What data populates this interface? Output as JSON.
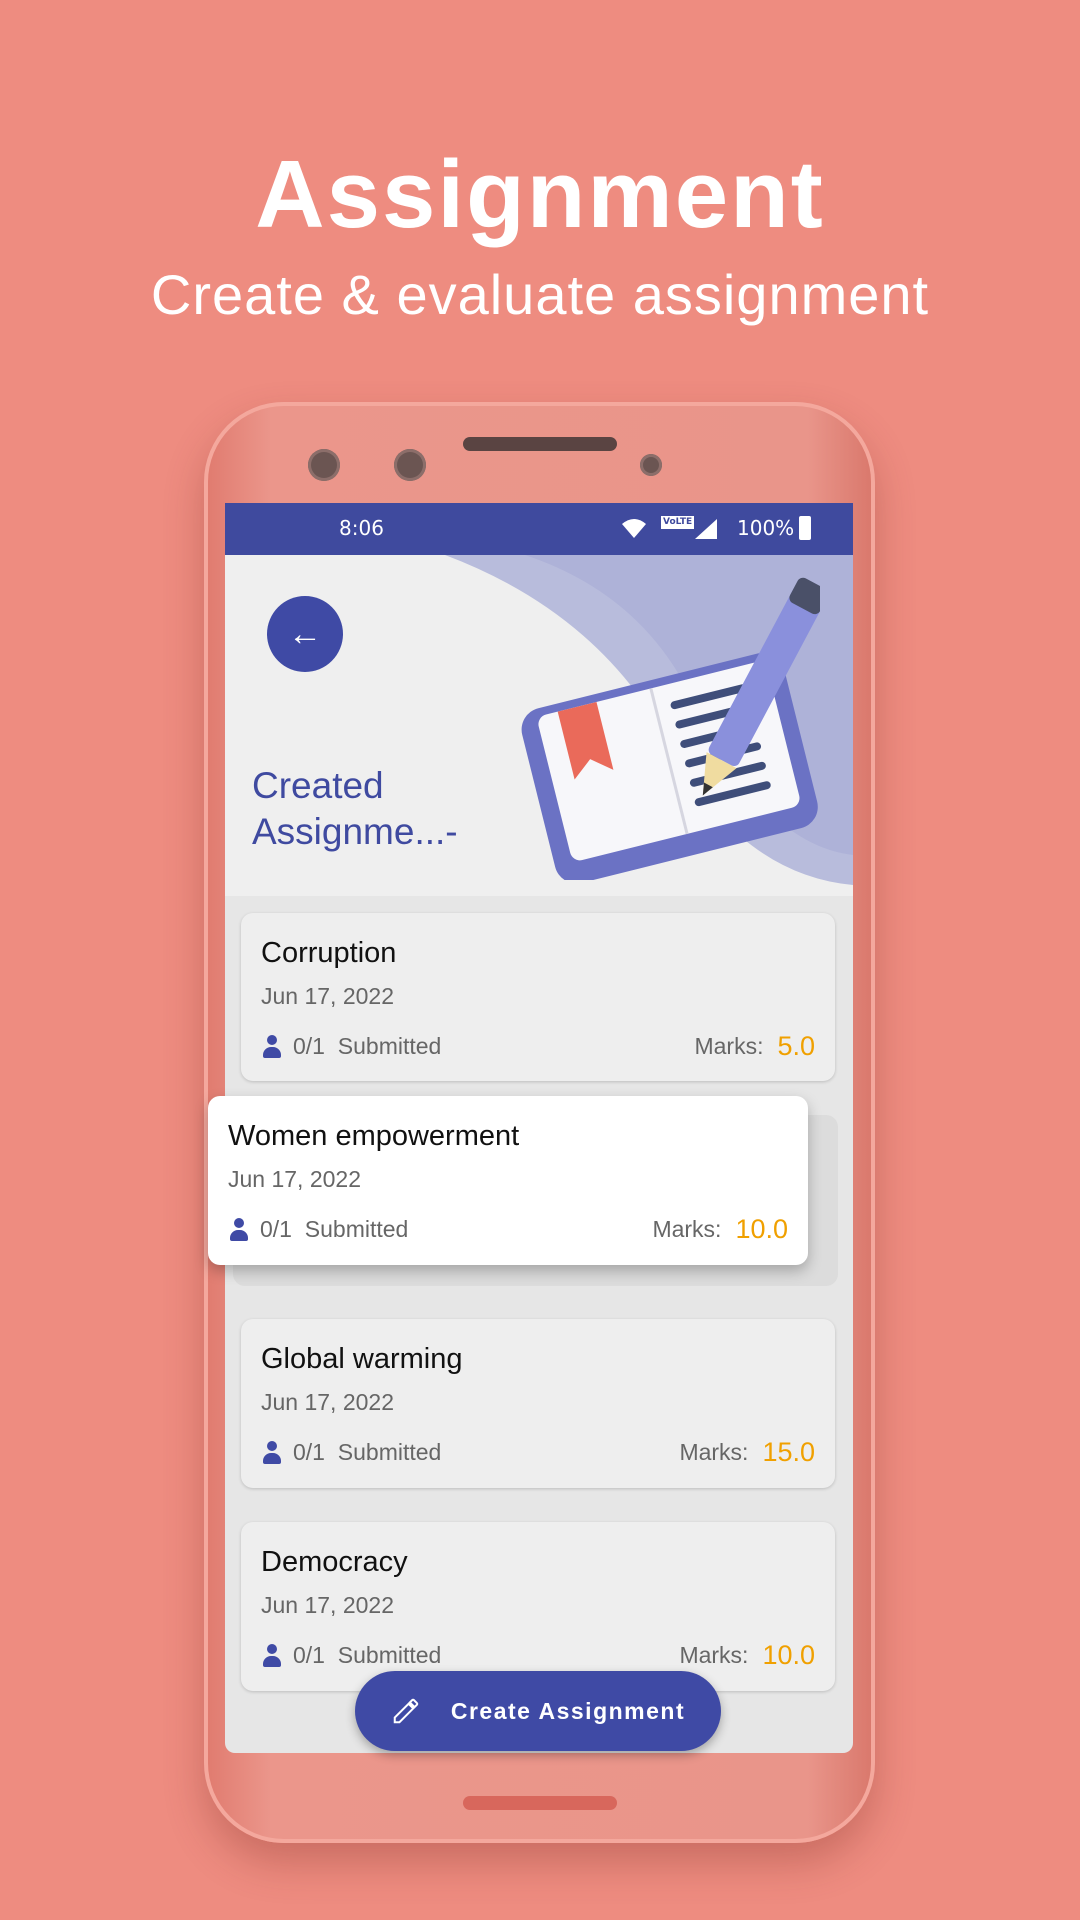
{
  "promo": {
    "title": "Assignment",
    "subtitle": "Create & evaluate assignment"
  },
  "status_bar": {
    "time": "8:06",
    "network": "VoLTE",
    "battery": "100%"
  },
  "header": {
    "title": "Created Assignme...-"
  },
  "assignments": [
    {
      "title": "Corruption",
      "date": "Jun 17, 2022",
      "submitted": "0/1",
      "submitted_label": "Submitted",
      "marks_label": "Marks:",
      "marks": "5.0"
    },
    {
      "title": "Women empowerment",
      "date": "Jun 17, 2022",
      "submitted": "0/1",
      "submitted_label": "Submitted",
      "marks_label": "Marks:",
      "marks": "10.0"
    },
    {
      "title": "Global warming",
      "date": "Jun 17, 2022",
      "submitted": "0/1",
      "submitted_label": "Submitted",
      "marks_label": "Marks:",
      "marks": "15.0"
    },
    {
      "title": "Democracy",
      "date": "Jun 17, 2022",
      "submitted": "0/1",
      "submitted_label": "Submitted",
      "marks_label": "Marks:",
      "marks": "10.0"
    }
  ],
  "fab": {
    "label": "Create Assignment"
  },
  "colors": {
    "primary": "#3f4aa5",
    "accent": "#f0a000",
    "background": "#ee8c80"
  }
}
